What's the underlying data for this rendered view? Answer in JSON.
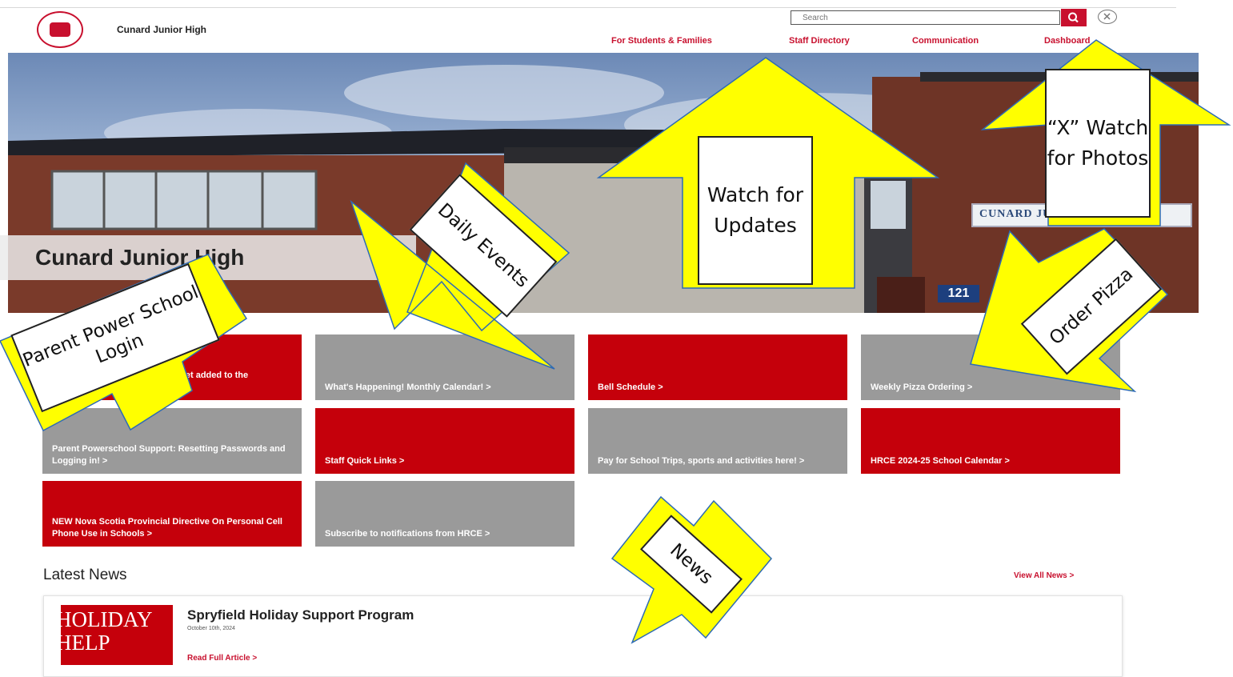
{
  "header": {
    "school_name": "Cunard Junior High",
    "search_placeholder": "Search",
    "nav": [
      "For Students & Families",
      "Staff Directory",
      "Communication",
      "Dashboard"
    ]
  },
  "hero": {
    "title": "Cunard Junior High",
    "sign_text": "CUNARD JUNIOR HIGH",
    "building_number": "121"
  },
  "tiles": [
    {
      "label": "Click here to see how you can get added to the PowerSchool ...  >",
      "color": "#c5000b"
    },
    {
      "label": "What's Happening! Monthly Calendar!  >",
      "color": "#9a9a9a"
    },
    {
      "label": "Bell Schedule  >",
      "color": "#c5000b"
    },
    {
      "label": "Weekly Pizza Ordering  >",
      "color": "#9a9a9a"
    },
    {
      "label": "Parent Powerschool Support: Resetting Passwords and Logging in!  >",
      "color": "#9a9a9a"
    },
    {
      "label": "Staff Quick Links  >",
      "color": "#c5000b"
    },
    {
      "label": "Pay for School Trips, sports and activities here!  >",
      "color": "#9a9a9a"
    },
    {
      "label": "HRCE 2024-25 School Calendar  >",
      "color": "#c5000b"
    },
    {
      "label": "NEW Nova Scotia Provincial Directive On Personal Cell Phone Use in Schools  >",
      "color": "#c5000b"
    },
    {
      "label": "Subscribe to notifications from HRCE  >",
      "color": "#9a9a9a"
    }
  ],
  "latest_news": {
    "heading": "Latest News",
    "view_all": "View All News  >",
    "items": [
      {
        "title": "Spryfield Holiday Support Program",
        "date": "October 10th, 2024",
        "read_more": "Read Full Article  >",
        "image_text": "HOLIDAY HELP"
      }
    ]
  },
  "annotations": {
    "updates": "Watch for Updates",
    "photos": "“X” Watch for Photos",
    "daily": "Daily Events",
    "pizza": "Order Pizza",
    "parent": "Parent Power School Login",
    "news": "News",
    "arrow_color": "#ffff00"
  }
}
